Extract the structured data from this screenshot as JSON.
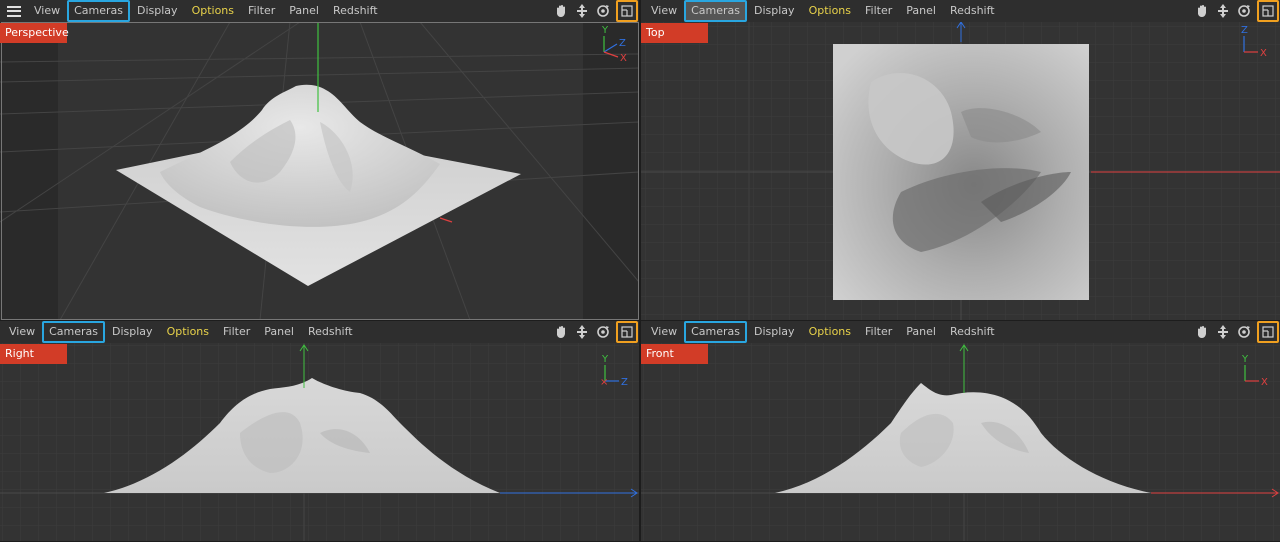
{
  "menu": {
    "view": "View",
    "cameras": "Cameras",
    "display": "Display",
    "options": "Options",
    "filter": "Filter",
    "panel": "Panel",
    "redshift": "Redshift"
  },
  "viewports": {
    "perspective": {
      "label": "Perspective"
    },
    "top": {
      "label": "Top"
    },
    "right": {
      "label": "Right"
    },
    "front": {
      "label": "Front"
    }
  },
  "axes": {
    "perspective": {
      "a": "Y",
      "b": "Z",
      "c": "X"
    },
    "top": {
      "a": "Z",
      "b": "X"
    },
    "right": {
      "a": "Y",
      "b": "Z"
    },
    "front": {
      "a": "Y",
      "b": "X"
    }
  },
  "colors": {
    "axis_x": "#e04040",
    "axis_y": "#40c040",
    "axis_z": "#3070e0",
    "label_bg": "#d23c27",
    "cameras_highlight": "#29a6e0",
    "frame_highlight": "#f0a020",
    "options_text": "#e8d24a"
  },
  "icons": [
    "hand-pan-icon",
    "move-arrows-icon",
    "orbit-icon",
    "frame-icon"
  ]
}
